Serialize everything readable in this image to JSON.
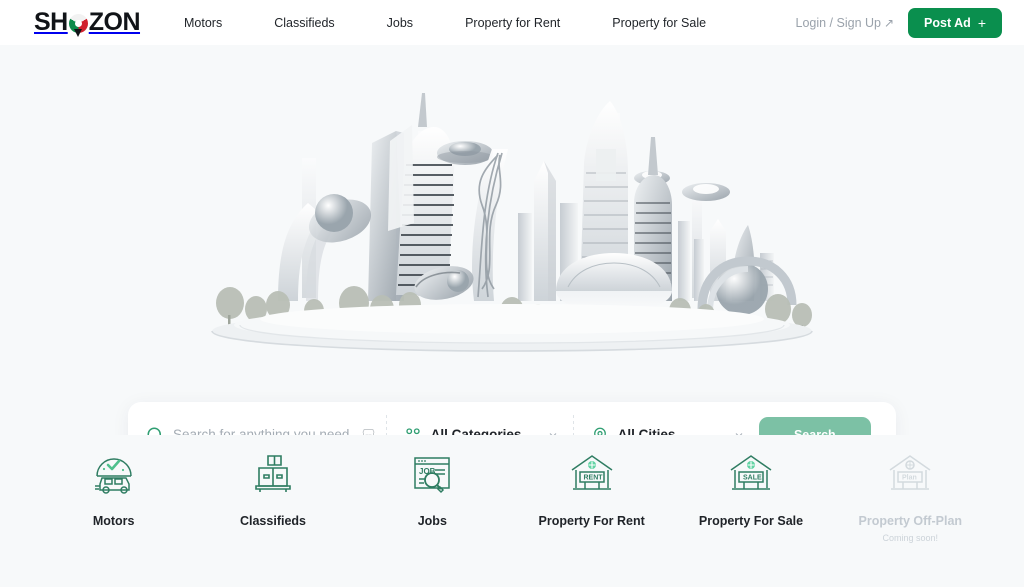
{
  "brand": {
    "name_part1": "SH",
    "name_part2": "ZON",
    "pin_icon": "location-pin-icon",
    "accent_green": "#0a8f4e",
    "accent_red": "#d0202e"
  },
  "header": {
    "nav": [
      {
        "label": "Motors"
      },
      {
        "label": "Classifieds"
      },
      {
        "label": "Jobs"
      },
      {
        "label": "Property for Rent"
      },
      {
        "label": "Property for Sale"
      }
    ],
    "login_label": "Login / Sign Up",
    "login_arrow": "↗",
    "post_ad_label": "Post Ad",
    "post_ad_plus": "+"
  },
  "hero": {
    "illustration_name": "futuristic-city-illustration"
  },
  "search": {
    "query_value": "",
    "query_placeholder": "Search for anything you need...",
    "query_icon": "search-circle-icon",
    "query_trailing_icon": "marketplace-icon",
    "category_icon": "grid-categories-icon",
    "category_value": "All Categories",
    "city_icon": "location-pin-icon",
    "city_value": "All Cities",
    "chevron_icon": "chevron-down-icon",
    "button_label": "Search",
    "button_color": "#7cc1a5"
  },
  "categories": [
    {
      "label": "Motors",
      "icon": "car-badge-icon",
      "sub": "",
      "disabled": false
    },
    {
      "label": "Classifieds",
      "icon": "stacked-boxes-icon",
      "sub": "",
      "disabled": false
    },
    {
      "label": "Jobs",
      "icon": "job-search-icon",
      "sub": "",
      "disabled": false
    },
    {
      "label": "Property For Rent",
      "icon": "house-rent-sign-icon",
      "sub": "",
      "disabled": false
    },
    {
      "label": "Property For Sale",
      "icon": "house-sale-sign-icon",
      "sub": "",
      "disabled": false
    },
    {
      "label": "Property Off-Plan",
      "icon": "house-plan-sign-icon",
      "sub": "Coming soon!",
      "disabled": true
    }
  ],
  "colors": {
    "page_background": "#f7f9fa",
    "header_background": "#ffffff",
    "icon_green": "#2f7d62",
    "text_dark": "#1f2328",
    "muted": "#a4acb4"
  }
}
